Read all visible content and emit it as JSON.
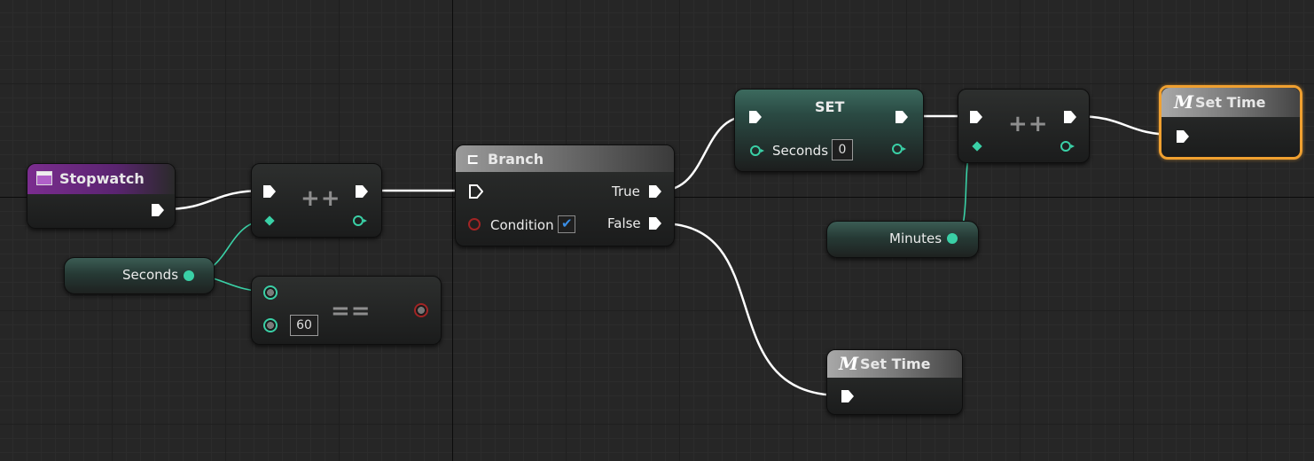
{
  "nodes": {
    "stopwatch": {
      "title": "Stopwatch",
      "header_color": "#7b2d8f"
    },
    "increment1": {
      "op": "++"
    },
    "seconds_var": {
      "label": "Seconds"
    },
    "equals": {
      "op": "==",
      "value": "60"
    },
    "branch": {
      "title": "Branch",
      "true_label": "True",
      "false_label": "False",
      "condition_label": "Condition",
      "condition_checked": true
    },
    "set": {
      "title": "SET",
      "seconds_label": "Seconds",
      "seconds_value": "0"
    },
    "increment2": {
      "op": "++"
    },
    "minutes_var": {
      "label": "Minutes"
    },
    "set_time_top": {
      "title": "Set Time",
      "icon": "M",
      "selected": true
    },
    "set_time_bottom": {
      "title": "Set Time",
      "icon": "M"
    }
  },
  "colors": {
    "wire": "#ffffff",
    "data_wire": "#3ad0a6",
    "selection": "#f0a030",
    "stopwatch_header": "#7b2d8f"
  },
  "icons": {
    "stopwatch": "widget-icon",
    "branch": "branch-icon",
    "set_time": "macro-icon",
    "checkbox": "checkmark-icon"
  }
}
